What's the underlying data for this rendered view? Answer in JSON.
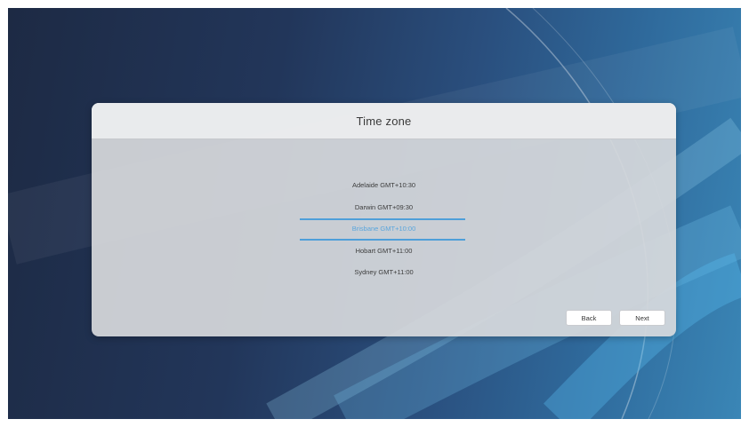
{
  "dialog": {
    "title": "Time zone",
    "zones": [
      {
        "label": "Adelaide GMT+10:30",
        "selected": false
      },
      {
        "label": "Darwin GMT+09:30",
        "selected": false
      },
      {
        "label": "Brisbane GMT+10:00",
        "selected": true
      },
      {
        "label": "Hobart GMT+11:00",
        "selected": false
      },
      {
        "label": "Sydney GMT+11:00",
        "selected": false
      }
    ],
    "back_label": "Back",
    "next_label": "Next"
  },
  "colors": {
    "accent": "#4e9fd9",
    "background_dark": "#1d2a44",
    "background_light": "#3a86b6"
  }
}
